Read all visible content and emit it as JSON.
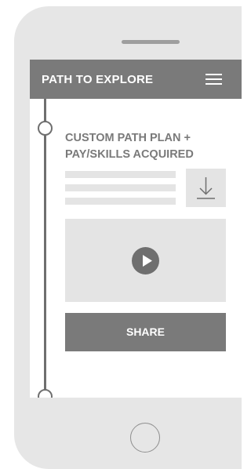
{
  "header": {
    "title": "PATH TO EXPLORE",
    "menu_icon": "hamburger-menu-icon"
  },
  "card": {
    "title": "CUSTOM PATH PLAN + PAY/SKILLS ACQUIRED",
    "download_icon": "download-icon",
    "play_icon": "play-icon"
  },
  "actions": {
    "share_label": "SHARE"
  },
  "device": {
    "home_button": "home-button",
    "speaker": "speaker-slot"
  },
  "colors": {
    "frame": "#e6e6e6",
    "header": "#7a7a7a",
    "placeholder": "#e4e4e4",
    "accent_dark": "#6f6f6f",
    "text_on_dark": "#ffffff"
  }
}
